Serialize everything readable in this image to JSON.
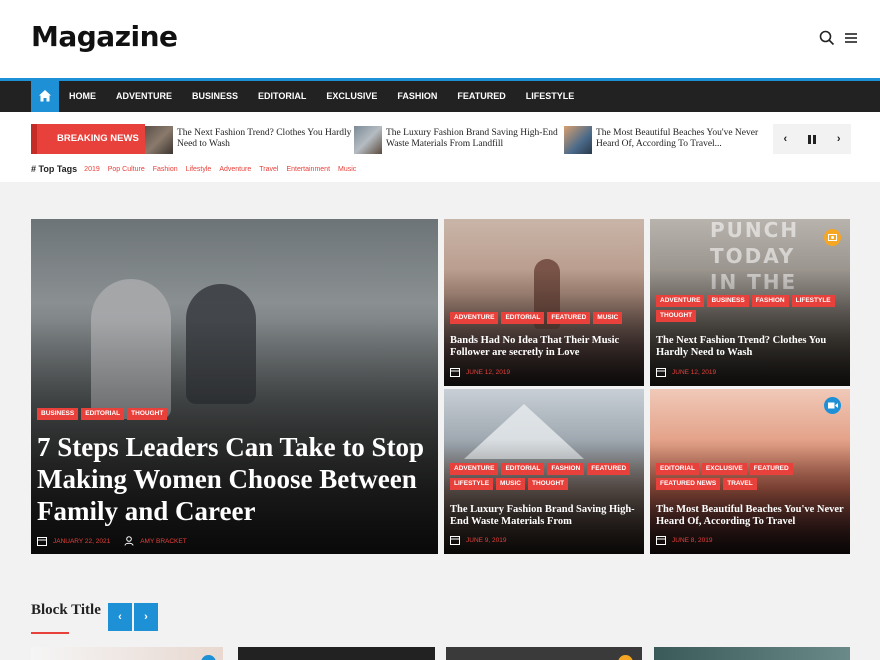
{
  "site": {
    "title": "Magazine"
  },
  "nav": {
    "items": [
      "HOME",
      "ADVENTURE",
      "BUSINESS",
      "EDITORIAL",
      "EXCLUSIVE",
      "FASHION",
      "FEATURED",
      "LIFESTYLE"
    ]
  },
  "breaking": {
    "label": "BREAKING NEWS",
    "items": [
      "The Next Fashion Trend? Clothes You Hardly Need to Wash",
      "The Luxury Fashion Brand Saving High-End Waste Materials From Landfill",
      "The Most Beautiful Beaches You've Never Heard Of, According To Travel..."
    ]
  },
  "tags": {
    "title": "# Top Tags",
    "items": [
      "2019",
      "Pop Culture",
      "Fashion",
      "Lifestyle",
      "Adventure",
      "Travel",
      "Entertainment",
      "Music"
    ]
  },
  "featured": {
    "main": {
      "cats": [
        "BUSINESS",
        "EDITORIAL",
        "THOUGHT"
      ],
      "title": "7 Steps Leaders Can Take to Stop Making Women Choose Between Family and Career",
      "date": "JANUARY 22, 2021",
      "author": "AMY BRACKET"
    },
    "cards": [
      {
        "cats": [
          "ADVENTURE",
          "EDITORIAL",
          "FEATURED",
          "MUSIC"
        ],
        "title": "Bands Had No Idea That Their Music Follower are secretly in Love",
        "date": "JUNE 12, 2019"
      },
      {
        "cats": [
          "ADVENTURE",
          "BUSINESS",
          "FASHION",
          "LIFESTYLE",
          "THOUGHT"
        ],
        "title": "The Next Fashion Trend? Clothes You Hardly Need to Wash",
        "date": "JUNE 12, 2019"
      },
      {
        "cats": [
          "ADVENTURE",
          "EDITORIAL",
          "FASHION",
          "FEATURED",
          "LIFESTYLE",
          "MUSIC",
          "THOUGHT"
        ],
        "title": "The Luxury Fashion Brand Saving High-End Waste Materials From",
        "date": "JUNE 9, 2019"
      },
      {
        "cats": [
          "EDITORIAL",
          "EXCLUSIVE",
          "FEATURED",
          "FEATURED NEWS",
          "TRAVEL"
        ],
        "title": "The Most Beautiful Beaches You've Never Heard Of, According To Travel",
        "date": "JUNE 8, 2019"
      }
    ]
  },
  "block": {
    "title": "Block Title",
    "prev": "‹",
    "next": "›"
  },
  "colors": {
    "accent": "#e8403a",
    "blue": "#1e90d6",
    "orange": "#f5a623",
    "nav_bg": "#222222"
  },
  "icons": [
    "search-icon",
    "menu-icon",
    "home-icon",
    "pause-icon",
    "chevron-left-icon",
    "chevron-right-icon",
    "calendar-icon",
    "user-icon",
    "gallery-icon",
    "video-icon"
  ]
}
